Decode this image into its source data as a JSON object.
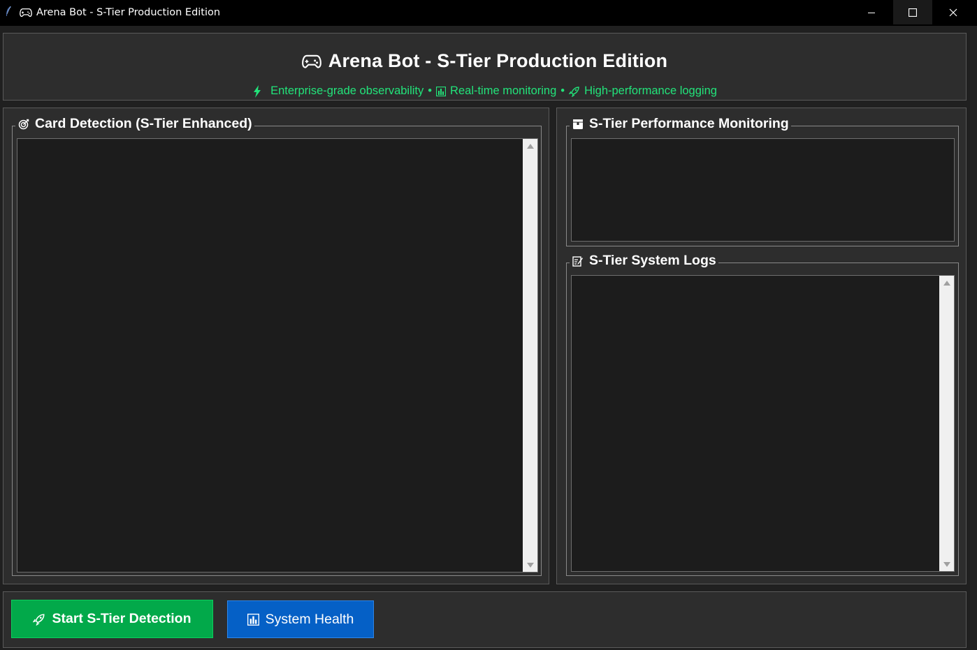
{
  "window": {
    "title": "Arena Bot - S-Tier Production Edition",
    "controls": {
      "minimize": "minimize-icon",
      "maximize": "maximize-icon",
      "close": "close-icon"
    }
  },
  "header": {
    "title": "Arena Bot - S-Tier Production Edition",
    "title_icon": "gamepad-icon",
    "features": [
      {
        "icon": "lightning-icon",
        "label": "Enterprise-grade observability"
      },
      {
        "icon": "bar-chart-icon",
        "label": "Real-time monitoring"
      },
      {
        "icon": "rocket-icon",
        "label": "High-performance logging"
      }
    ],
    "separator": "•"
  },
  "panels": {
    "card_detection": {
      "label": "Card Detection (S-Tier Enhanced)",
      "icon": "target-icon",
      "text": ""
    },
    "performance": {
      "label": "S-Tier Performance Monitoring",
      "icon": "package-icon",
      "text": ""
    },
    "logs": {
      "label": "S-Tier System Logs",
      "icon": "memo-icon",
      "text": ""
    }
  },
  "footer": {
    "start_button": {
      "label": "Start S-Tier Detection",
      "icon": "rocket-icon"
    },
    "health_button": {
      "label": "System Health",
      "icon": "bar-chart-icon"
    }
  },
  "colors": {
    "accent_green": "#22e37a",
    "start_button": "#02a94a",
    "health_button": "#0560c6",
    "panel_bg": "#2d2d2d",
    "text_area_bg": "#1c1c1c"
  }
}
